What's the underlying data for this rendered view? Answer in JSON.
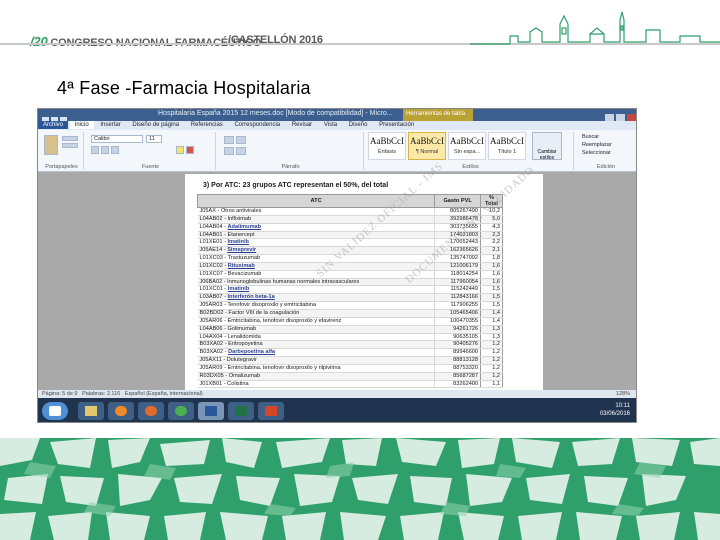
{
  "header": {
    "congreso_num": "/20",
    "congreso_text": "CONGRESO NACIONAL FARMACÉUTICO",
    "city": "/CASTELLÓN 2016"
  },
  "slide": {
    "title": "4ª Fase -Farmacia Hospitalaria"
  },
  "word": {
    "window_title": "Hospitalaria España 2015 12 meses.doc [Modo de compatibilidad] - Micro...",
    "context_tab": "Herramientas de tabla",
    "tabs": [
      "Archivo",
      "Inicio",
      "Insertar",
      "Diseño de página",
      "Referencias",
      "Correspondencia",
      "Revisar",
      "Vista",
      "Diseño",
      "Presentación"
    ],
    "active_tab": "Inicio",
    "ribbon": {
      "paste_group": "Portapapeles",
      "font_group": "Fuente",
      "paragraph_group": "Párrafo",
      "styles_group": "Estilos",
      "editing_group": "Edición",
      "font_name": "Calibri",
      "font_size": "11",
      "styles": [
        {
          "sample": "AaBbCcI",
          "name": "Énfasis"
        },
        {
          "sample": "AaBbCcI",
          "name": "¶ Normal"
        },
        {
          "sample": "AaBbCcI",
          "name": "Sin espa..."
        },
        {
          "sample": "AaBbCcI",
          "name": "Título 1"
        }
      ],
      "change_styles": "Cambiar estilos",
      "editing": [
        "Buscar",
        "Reemplazar",
        "Seleccionar"
      ]
    },
    "document": {
      "heading": "3)  Por ATC: 23 grupos ATC representan el 50%, del total",
      "columns": [
        "ATC",
        "Gasto PVL",
        "% Total"
      ],
      "rows": [
        {
          "atc": "J05AX - Otros antivirales",
          "gasto": "805267490",
          "pct": "10,2"
        },
        {
          "atc": "L04AB02 - Infliximab",
          "gasto": "392986478",
          "pct": "5,0"
        },
        {
          "atc": "L04AB04 - Adalimumab",
          "gasto": "303735655",
          "pct": "4,3"
        },
        {
          "atc": "L04AB01 - Etanercept",
          "gasto": "174031803",
          "pct": "2,3"
        },
        {
          "atc": "L01XE01 - Imatinib",
          "gasto": "170652443",
          "pct": "2,2"
        },
        {
          "atc": "J05AE14 - Simeprevir",
          "gasto": "162365626",
          "pct": "2,1"
        },
        {
          "atc": "L01XC03 - Trastuzumab",
          "gasto": "135747092",
          "pct": "1,8"
        },
        {
          "atc": "L01XC02 - Rituximab",
          "gasto": "121006179",
          "pct": "1,6"
        },
        {
          "atc": "L01XC07 - Bevacizumab",
          "gasto": "118014254",
          "pct": "1,6"
        },
        {
          "atc": "J06BA02 - Inmunoglobulinas humanas normales intravasculares",
          "gasto": "117960054",
          "pct": "1,6"
        },
        {
          "atc": "L01XC01 - Imatinib",
          "gasto": "115242449",
          "pct": "1,5"
        },
        {
          "atc": "L03AB07 - Interferón beta-1a",
          "gasto": "112843166",
          "pct": "1,5"
        },
        {
          "atc": "J05AR03 - Tenofovir disoproxilo y emtricitabina",
          "gasto": "117906255",
          "pct": "1,5"
        },
        {
          "atc": "B02BD02 - Factor VIII de la coagulación",
          "gasto": "105465406",
          "pct": "1,4"
        },
        {
          "atc": "J05AR06 - Emtricitabina, tenofovir disoproxilo y efavirenz",
          "gasto": "100470355",
          "pct": "1,4"
        },
        {
          "atc": "L04AB06 - Golimumab",
          "gasto": "94261726",
          "pct": "1,3"
        },
        {
          "atc": "L04AX04 - Lenalidomida",
          "gasto": "90635105",
          "pct": "1,3"
        },
        {
          "atc": "B03XA02 - Eritropoyetina",
          "gasto": "90405276",
          "pct": "1,2"
        },
        {
          "atc": "B03XA02 - Darbepoetina alfa",
          "gasto": "89946600",
          "pct": "1,2"
        },
        {
          "atc": "J05AX11 - Dolutegravir",
          "gasto": "88813128",
          "pct": "1,2"
        },
        {
          "atc": "J05AR09 - Emtricitabina, tenofovir disoproxilo y rilpivirina",
          "gasto": "88753320",
          "pct": "1,2"
        },
        {
          "atc": "R03DX05 - Omalizumab",
          "gasto": "85687287",
          "pct": "1,2"
        },
        {
          "atc": "J01XB01 - Colistina",
          "gasto": "83262400",
          "pct": "1,1"
        }
      ],
      "watermark_1": "SIN VALIDEZ OFICIAL - IMS",
      "watermark_2": "DOCUMENTO NO VALIDADO"
    },
    "statusbar": {
      "page": "Página: 5 de 9",
      "words": "Palabras: 2.116",
      "language": "Español (España, internacional)",
      "zoom": "128%"
    },
    "taskbar": {
      "time": "10:11",
      "date": "03/06/2016"
    }
  },
  "colors": {
    "brand_green": "#2f9f6c",
    "word_blue": "#2b579a"
  }
}
